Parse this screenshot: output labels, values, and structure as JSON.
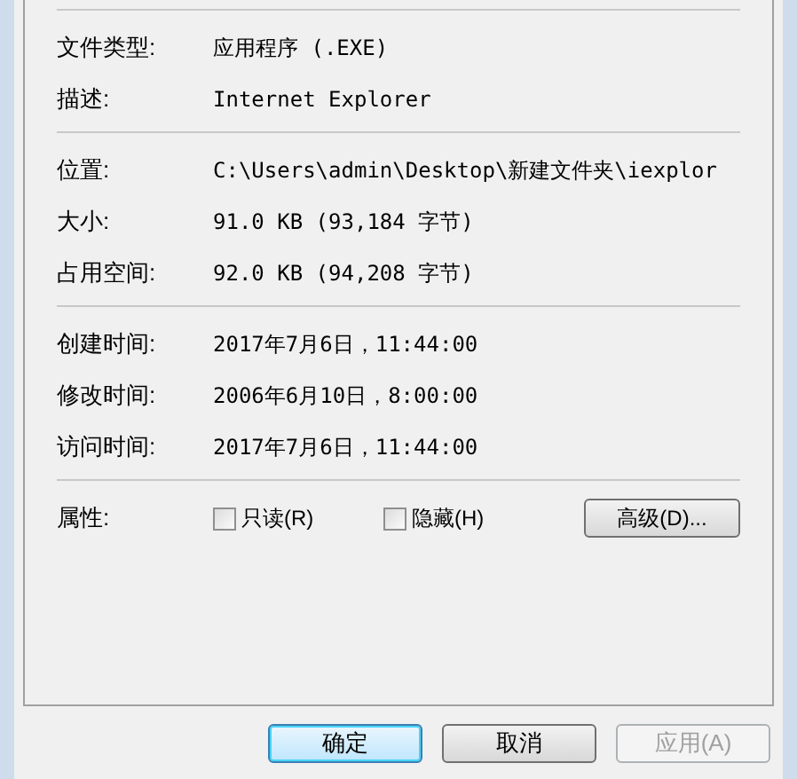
{
  "sections": [
    {
      "rows": [
        {
          "label": "文件类型:",
          "value": "应用程序 (.EXE)"
        },
        {
          "label": "描述:",
          "value": "Internet Explorer"
        }
      ]
    },
    {
      "rows": [
        {
          "label": "位置:",
          "value": "C:\\Users\\admin\\Desktop\\新建文件夹\\iexplor"
        },
        {
          "label": "大小:",
          "value": "91.0 KB (93,184 字节)"
        },
        {
          "label": "占用空间:",
          "value": "92.0 KB (94,208 字节)"
        }
      ]
    },
    {
      "rows": [
        {
          "label": "创建时间:",
          "value": "2017年7月6日，11:44:00"
        },
        {
          "label": "修改时间:",
          "value": "2006年6月10日，8:00:00"
        },
        {
          "label": "访问时间:",
          "value": "2017年7月6日，11:44:00"
        }
      ]
    }
  ],
  "attributes": {
    "label": "属性:",
    "checkboxes": [
      {
        "label": "只读(R)",
        "checked": false
      },
      {
        "label": "隐藏(H)",
        "checked": false
      }
    ],
    "advanced_button": "高级(D)..."
  },
  "buttons": [
    {
      "label": "确定",
      "default": true,
      "disabled": false
    },
    {
      "label": "取消",
      "default": false,
      "disabled": false
    },
    {
      "label": "应用(A)",
      "default": false,
      "disabled": true
    }
  ]
}
